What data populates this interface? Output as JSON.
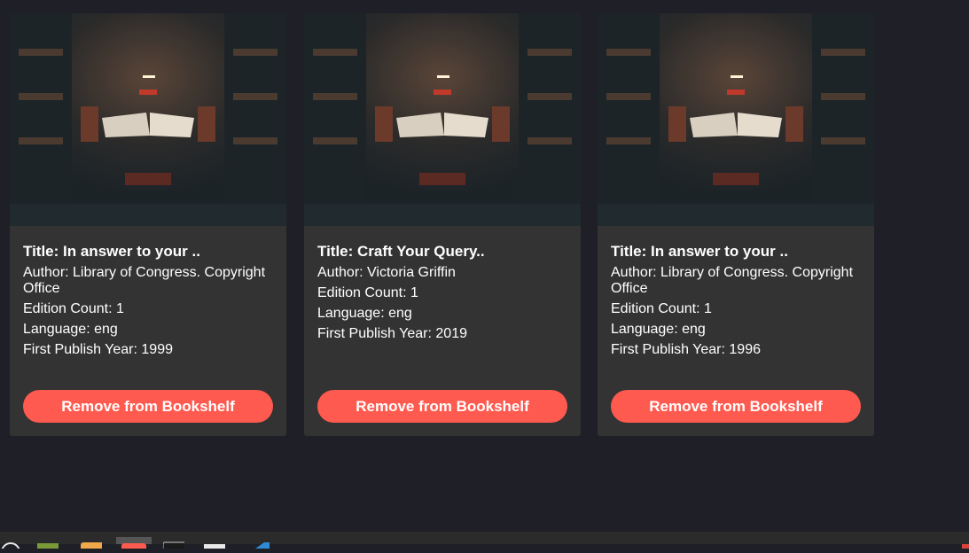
{
  "cards": [
    {
      "title": "Title: In answer to your ..",
      "author": "Author: Library of Congress. Copyright Office",
      "edition_count": "Edition Count: 1",
      "language": "Language: eng",
      "first_publish_year": "First Publish Year: 1999",
      "button_label": "Remove from Bookshelf"
    },
    {
      "title": "Title: Craft Your Query..",
      "author": "Author: Victoria Griffin",
      "edition_count": "Edition Count: 1",
      "language": "Language: eng",
      "first_publish_year": "First Publish Year: 2019",
      "button_label": "Remove from Bookshelf"
    },
    {
      "title": "Title: In answer to your ..",
      "author": "Author: Library of Congress. Copyright Office",
      "edition_count": "Edition Count: 1",
      "language": "Language: eng",
      "first_publish_year": "First Publish Year: 1996",
      "button_label": "Remove from Bookshelf"
    }
  ],
  "colors": {
    "page_background": "#1f1f27",
    "card_background": "#333333",
    "button_background": "#ff5a4f"
  },
  "taskbar": {
    "icons": [
      "app-menu-icon",
      "desktop-icon",
      "files-icon",
      "browser-icon",
      "terminal-icon",
      "folder-icon",
      "editor-icon"
    ]
  }
}
